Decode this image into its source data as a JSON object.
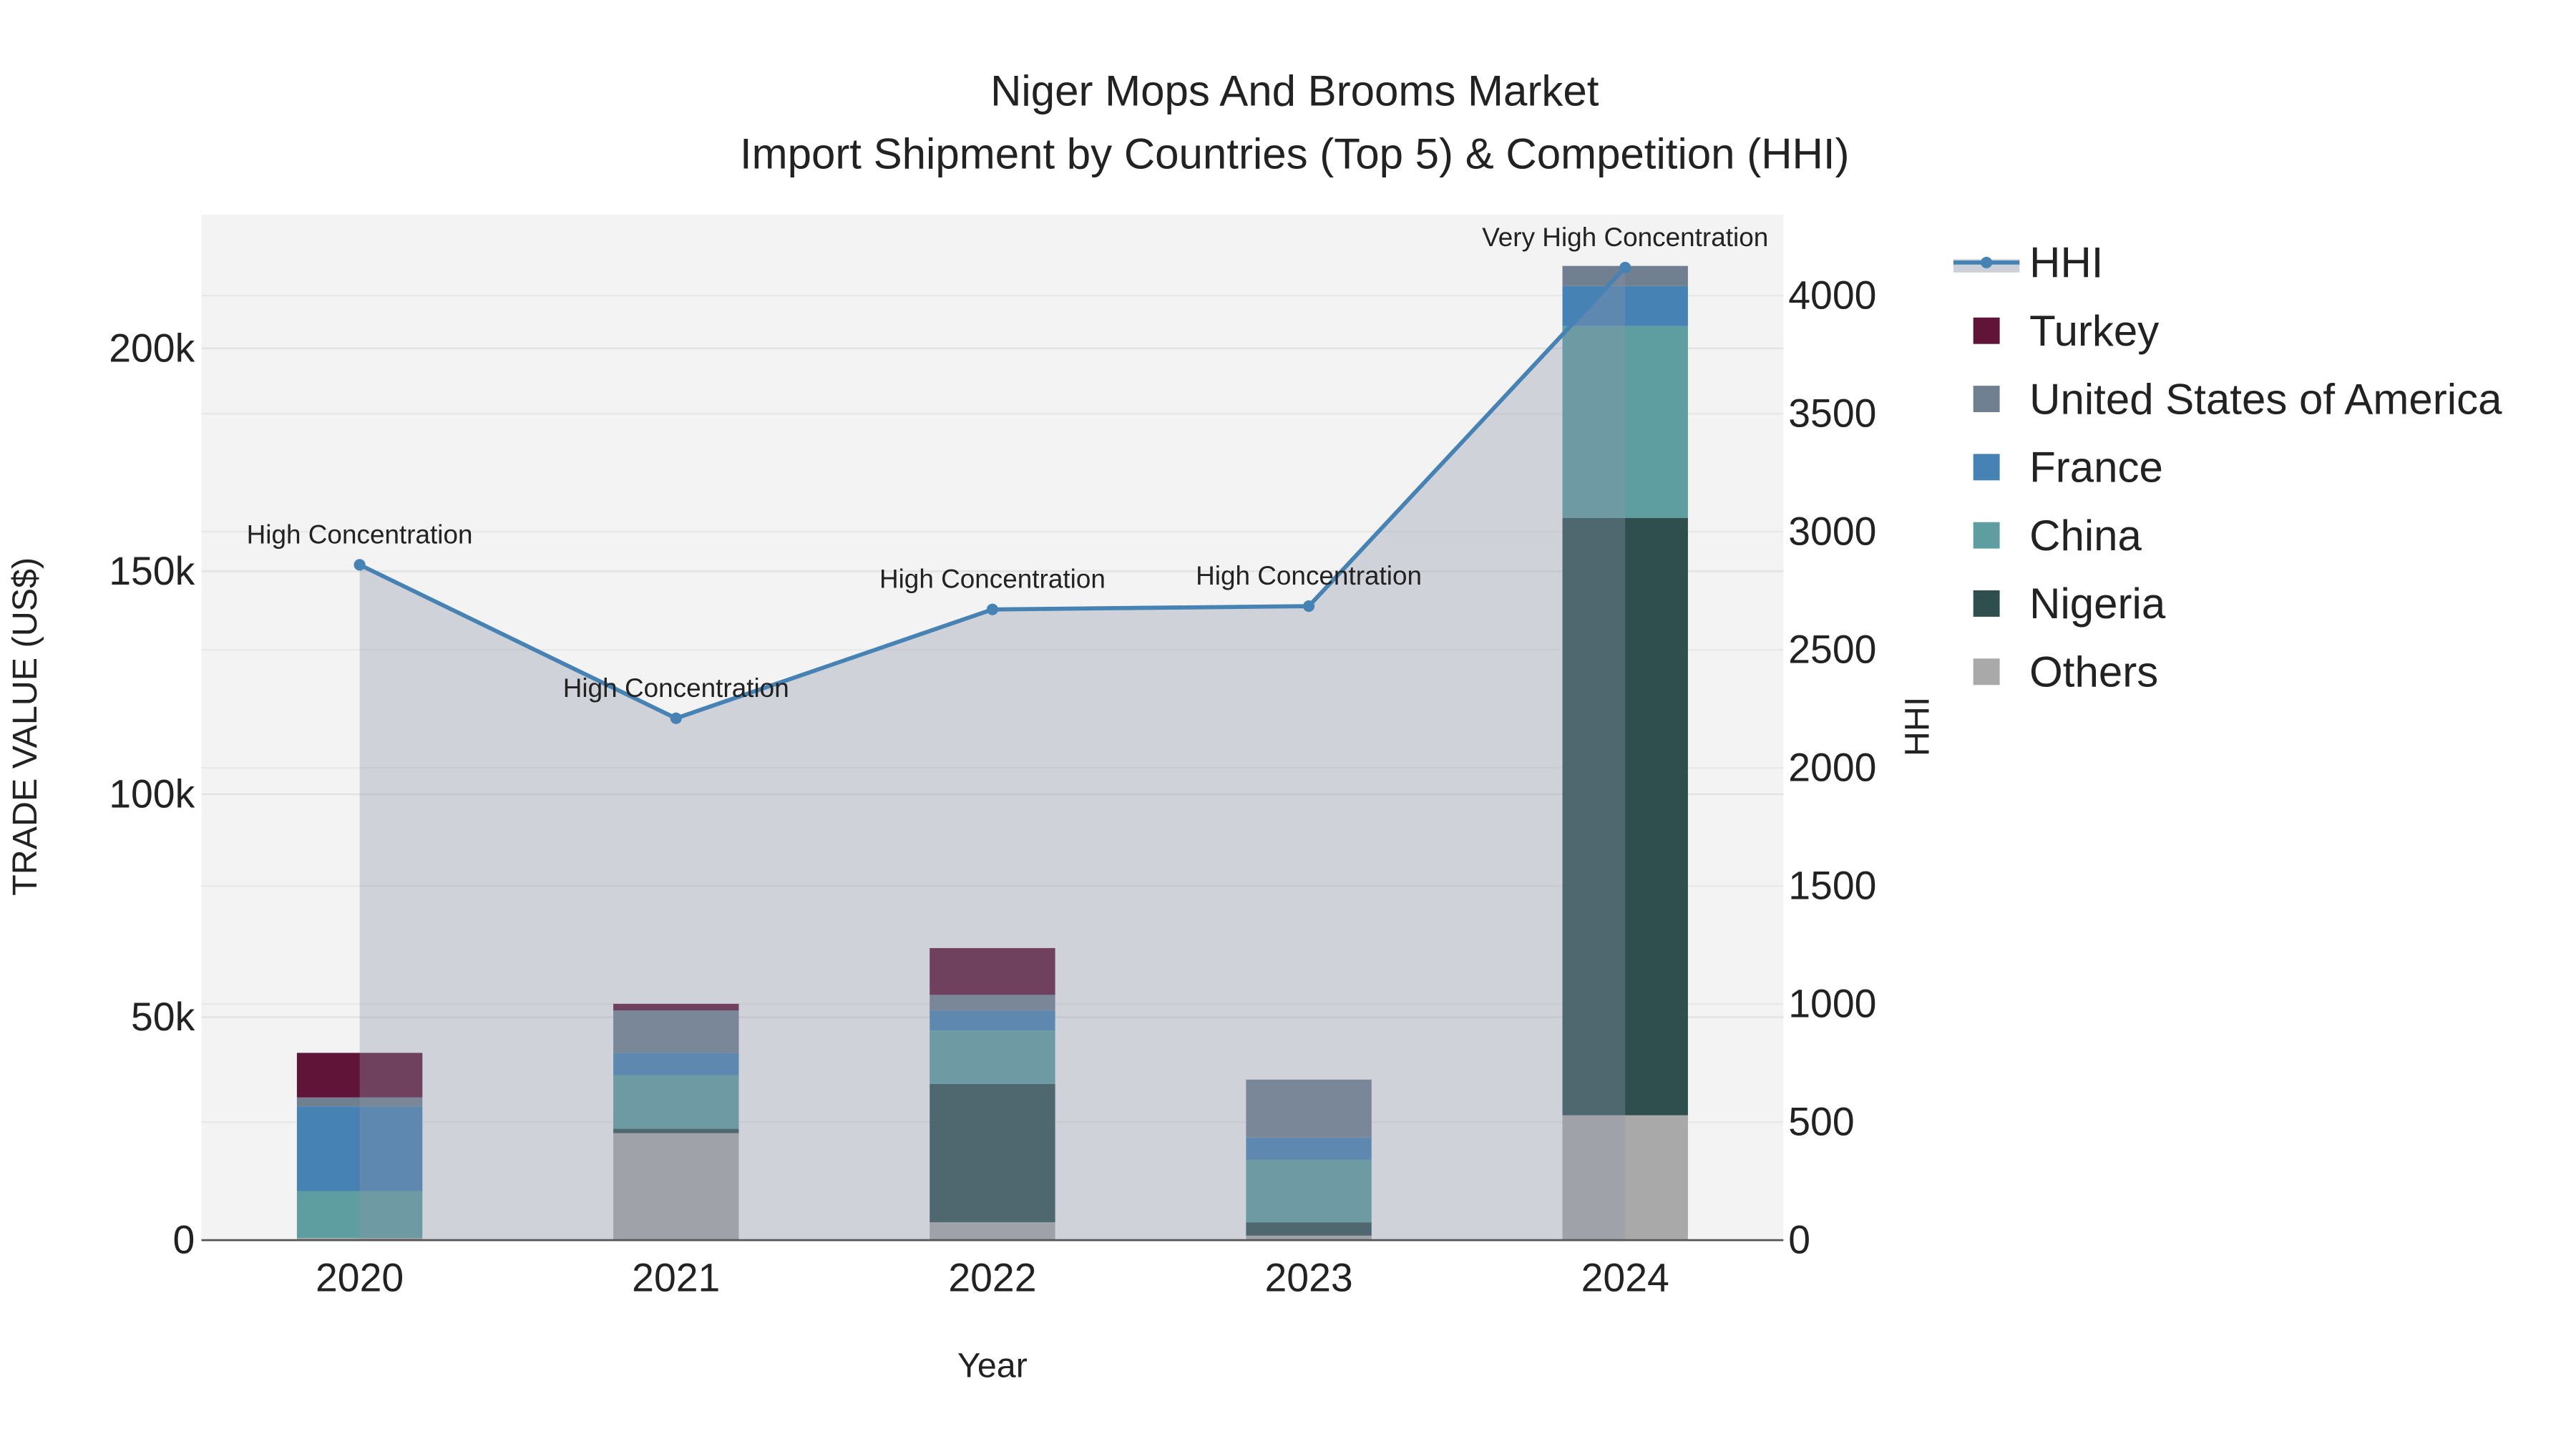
{
  "chart_data": {
    "type": "bar",
    "title": "Niger Mops And Brooms Market",
    "subtitle": "Import Shipment by Countries (Top 5) & Competition (HHI)",
    "xlabel": "Year",
    "ylabel": "TRADE VALUE (US$)",
    "y2label": "HHI",
    "categories": [
      "2020",
      "2021",
      "2022",
      "2023",
      "2024"
    ],
    "ylim": [
      0,
      230000
    ],
    "y_ticks": [
      0,
      50000,
      100000,
      150000,
      200000
    ],
    "y_tick_labels": [
      "0",
      "50k",
      "100k",
      "150k",
      "200k"
    ],
    "y2lim": [
      0,
      4343
    ],
    "y2_ticks": [
      0,
      500,
      1000,
      1500,
      2000,
      2500,
      3000,
      3500,
      4000
    ],
    "y2_tick_labels": [
      "0",
      "500",
      "1000",
      "1500",
      "2000",
      "2500",
      "3000",
      "3500",
      "4000"
    ],
    "series": [
      {
        "name": "Others",
        "color": "#a9a9a9",
        "values": [
          500,
          24000,
          4000,
          1000,
          28000
        ]
      },
      {
        "name": "Nigeria",
        "color": "#2f4f4f",
        "values": [
          0,
          1000,
          31000,
          3000,
          134000
        ]
      },
      {
        "name": "China",
        "color": "#5f9ea0",
        "values": [
          10500,
          12000,
          12000,
          14000,
          43000
        ]
      },
      {
        "name": "France",
        "color": "#4682b4",
        "values": [
          19000,
          5000,
          4500,
          5000,
          9000
        ]
      },
      {
        "name": "United States of America",
        "color": "#708090",
        "values": [
          2000,
          9500,
          3500,
          13000,
          4500
        ]
      },
      {
        "name": "Turkey",
        "color": "#601438",
        "values": [
          10000,
          1500,
          10500,
          0,
          0
        ]
      }
    ],
    "hhi": {
      "name": "HHI",
      "color": "#4682b4",
      "values": [
        2860,
        2210,
        2671,
        2685,
        4119
      ],
      "labels": [
        "High Concentration",
        "High Concentration",
        "High Concentration",
        "High Concentration",
        "Very High Concentration"
      ]
    },
    "legend_order": [
      "HHI",
      "Turkey",
      "United States of America",
      "France",
      "China",
      "Nigeria",
      "Others"
    ],
    "legend_placement": "right",
    "grid": true
  }
}
